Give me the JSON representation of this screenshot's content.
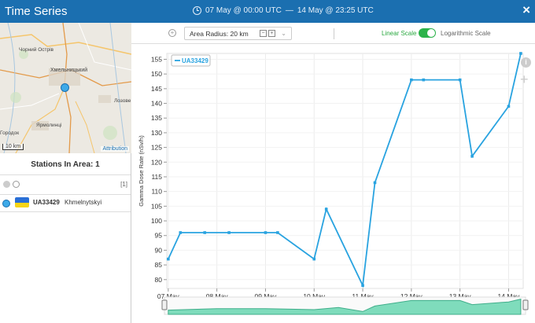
{
  "window": {
    "title": "Time Series",
    "range_start": "07 May @ 00:00 UTC",
    "range_sep": "—",
    "range_end": "14 May @ 23:25 UTC",
    "close": "×"
  },
  "map": {
    "labels": [
      {
        "text": "Чорний Острів"
      },
      {
        "text": "Хмельницький"
      },
      {
        "text": "Лозове"
      },
      {
        "text": "Ярмолинці"
      },
      {
        "text": "Городок"
      }
    ],
    "scale": "10 km",
    "attribution": "Attribution"
  },
  "stations": {
    "heading": "Stations In Area: 1",
    "count_badge": "[1]",
    "items": [
      {
        "id": "UA33429",
        "name": "Khmelnytskyi",
        "flag_top": "#2a6fd6",
        "flag_bottom": "#f7d417"
      }
    ]
  },
  "toolbar": {
    "add_icon": "plus-circle-icon",
    "radius_label": "Area Radius: 20 km",
    "radius_minus": "−",
    "radius_plus": "+",
    "linear_label": "Linear Scale",
    "log_label": "Logarithmic Scale"
  },
  "side": {
    "info": "i",
    "zoom": "+"
  },
  "chart_data": {
    "type": "line",
    "ylabel": "Gamma Dose Rate (nSv/h)",
    "ylim": [
      77,
      157
    ],
    "yticks": [
      80,
      85,
      90,
      95,
      100,
      105,
      110,
      115,
      120,
      125,
      130,
      135,
      140,
      145,
      150,
      155
    ],
    "xticks": [
      "07 May",
      "08 May",
      "09 May",
      "10 May",
      "11 May",
      "12 May",
      "13 May",
      "14 May"
    ],
    "series": [
      {
        "name": "UA33429",
        "color": "#29a3e0",
        "x": [
          7.0,
          7.25,
          7.75,
          8.25,
          9.0,
          9.25,
          10.0,
          10.25,
          11.0,
          11.25,
          12.0,
          12.25,
          13.0,
          13.25,
          14.0,
          14.25
        ],
        "y": [
          87,
          96,
          96,
          96,
          96,
          96,
          87,
          104,
          78,
          113,
          148,
          148,
          148,
          122,
          139,
          157
        ]
      }
    ],
    "overview": {
      "x": [
        7.0,
        8.0,
        9.0,
        10.0,
        10.5,
        11.0,
        11.25,
        12.0,
        13.0,
        13.25,
        14.0,
        14.25
      ],
      "y": [
        87,
        96,
        96,
        90,
        104,
        78,
        113,
        148,
        148,
        122,
        139,
        157
      ]
    }
  }
}
